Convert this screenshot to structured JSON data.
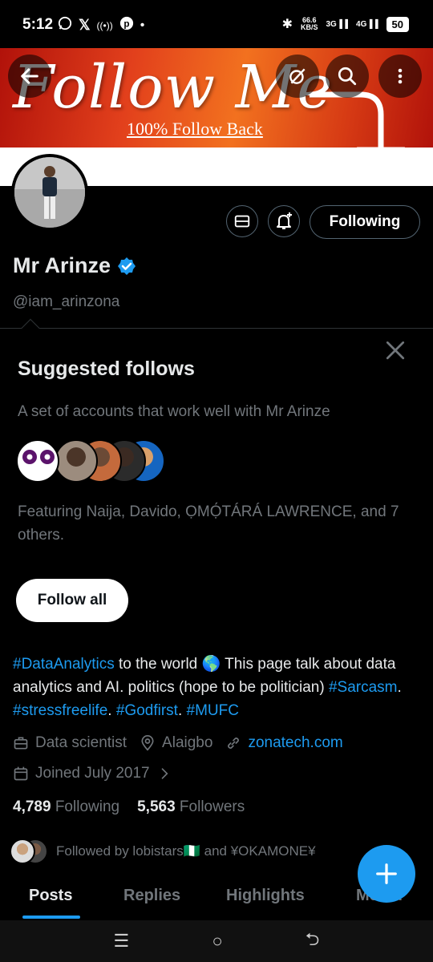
{
  "status_bar": {
    "time": "5:12",
    "left_icons": [
      "whatsapp-icon",
      "x-icon",
      "radio-icon",
      "pinterest-icon",
      "dot-icon"
    ],
    "speed_value": "66.6",
    "speed_unit": "KB/S",
    "net1": "3G",
    "net2": "4G",
    "battery": "50"
  },
  "banner": {
    "title": "Follow Me",
    "subtitle": "100% Follow Back"
  },
  "profile": {
    "display_name": "Mr Arinze",
    "handle": "@iam_arinzona",
    "following_button": "Following"
  },
  "suggested": {
    "title": "Suggested follows",
    "description": "A set of accounts that work well with Mr Arinze",
    "featuring": "Featuring Naija, Davido, ỌMỌ́TÁRÁ LAWRENCE, and 7 others.",
    "follow_all": "Follow all"
  },
  "bio": {
    "tag1": "#DataAnalytics",
    "text1": " to the world 🌎  This page talk about data analytics and AI. politics (hope to be politician) ",
    "tag2": "#Sarcasm",
    "sep1": ". ",
    "tag3": "#stressfreelife",
    "sep2": ". ",
    "tag4": "#Godfirst",
    "sep3": ". ",
    "tag5": "#MUFC"
  },
  "meta": {
    "profession": "Data scientist",
    "location": "Alaigbo",
    "website": "zonatech.com",
    "joined": "Joined July 2017"
  },
  "stats": {
    "following_count": "4,789",
    "following_label": "Following",
    "followers_count": "5,563",
    "followers_label": "Followers"
  },
  "followed_by": "Followed by lobistars🇳🇬 and ¥OKAMONE¥",
  "tabs": [
    "Posts",
    "Replies",
    "Highlights",
    "Media"
  ],
  "colors": {
    "accent": "#1d9bf0",
    "muted": "#71767b",
    "background": "#000000"
  }
}
